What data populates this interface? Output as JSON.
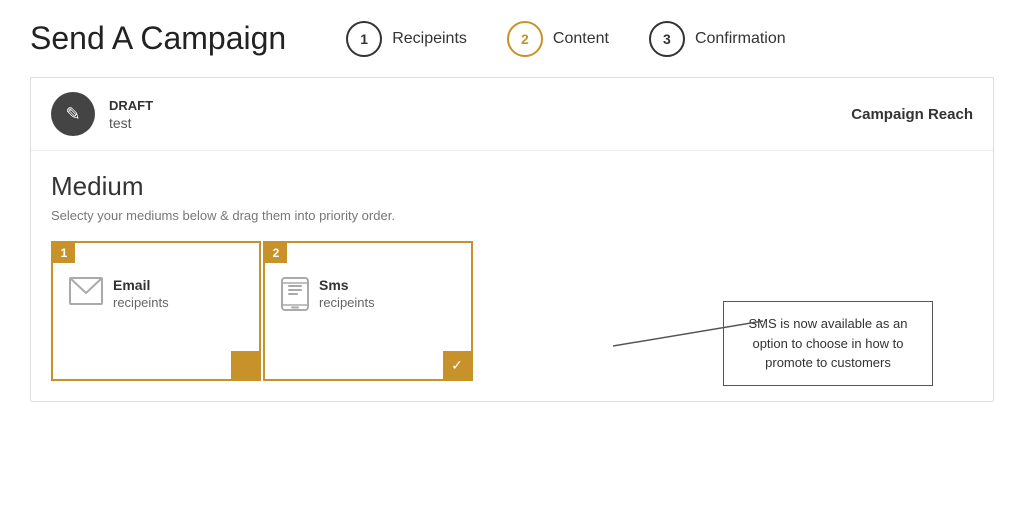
{
  "header": {
    "title": "Send A Campaign",
    "steps": [
      {
        "number": "1",
        "label": "Recipeints",
        "active": false
      },
      {
        "number": "2",
        "label": "Content",
        "active": true
      },
      {
        "number": "3",
        "label": "Confirmation",
        "active": false
      }
    ]
  },
  "card": {
    "draft_label": "DRAFT",
    "draft_name": "test",
    "campaign_reach": "Campaign Reach",
    "draft_icon": "✎",
    "medium": {
      "title": "Medium",
      "subtitle": "Selecty your mediums below & drag them into priority order.",
      "cards": [
        {
          "number": "1",
          "name": "Email",
          "sub": "recipeints",
          "has_check": false
        },
        {
          "number": "2",
          "name": "Sms",
          "sub": "recipeints",
          "has_check": true
        }
      ]
    },
    "callout": "SMS is now available as an option to choose in how to promote to customers"
  }
}
